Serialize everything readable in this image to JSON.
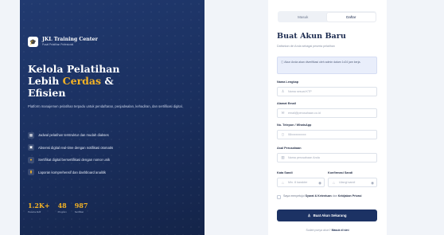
{
  "brand": {
    "name": "JKL Training Center",
    "subtitle": "Pusat Pelatihan Profesional"
  },
  "hero": {
    "headline_line1": "Kelola Pelatihan",
    "headline_line2_start": "Lebih ",
    "headline_accent": "Cerdas",
    "headline_line2_end": " &",
    "headline_line3": "Efisien",
    "lead": "Platform manajemen pelatihan terpadu untuk pendaftaran, penjadwalan, kehadiran, dan sertifikasi digital."
  },
  "features": [
    {
      "icon": "calendar-icon",
      "text": "Jadwal pelatihan terstruktur dan mudah diakses"
    },
    {
      "icon": "qr-icon",
      "text": "Absensi digital real-time dengan notifikasi otomatis"
    },
    {
      "icon": "certificate-icon",
      "text": "Sertifikat digital bersertifikasi dengan nomor unik"
    },
    {
      "icon": "bar-chart-icon",
      "text": "Laporan komprehensif dan dashboard analitik"
    }
  ],
  "stats": [
    {
      "value": "1.2K+",
      "label": "Peserta Aktif"
    },
    {
      "value": "48",
      "label": "Program"
    },
    {
      "value": "987",
      "label": "Sertifikat"
    }
  ],
  "tabs": {
    "login": "Masuk",
    "register": "Daftar"
  },
  "form": {
    "title": "Buat Akun Baru",
    "subtitle": "Daftarkan diri Anda sebagai peserta pelatihan",
    "alert": "Akun Anda akan diverifikasi oleh admin dalam 1x24 jam kerja.",
    "full_name": {
      "label": "Nama Lengkap",
      "placeholder": "Nama sesuai KTP"
    },
    "email": {
      "label": "Alamat Email",
      "placeholder": "email@perusahaan.co.id"
    },
    "phone": {
      "label": "No. Telepon / WhatsApp",
      "placeholder": "08xxxxxxxxxx"
    },
    "company": {
      "label": "Asal Perusahaan",
      "placeholder": "Nama perusahaan Anda"
    },
    "password": {
      "label": "Kata Sandi",
      "placeholder": "Min. 8 karakter"
    },
    "confirm": {
      "label": "Konfirmasi Sandi",
      "placeholder": "Ulangi sandi"
    },
    "terms_prefix": "Saya menyetujui ",
    "terms_link1": "Syarat & Ketentuan",
    "terms_mid": " dan ",
    "terms_link2": "Kebijakan Privasi",
    "submit": "Buat Akun Sekarang",
    "footer_prefix": "Sudah punya akun? ",
    "footer_link": "Masuk di sini"
  },
  "colors": {
    "navy": "#1c3264",
    "accent": "#f5b324",
    "page_bg": "#f1f4f9"
  }
}
